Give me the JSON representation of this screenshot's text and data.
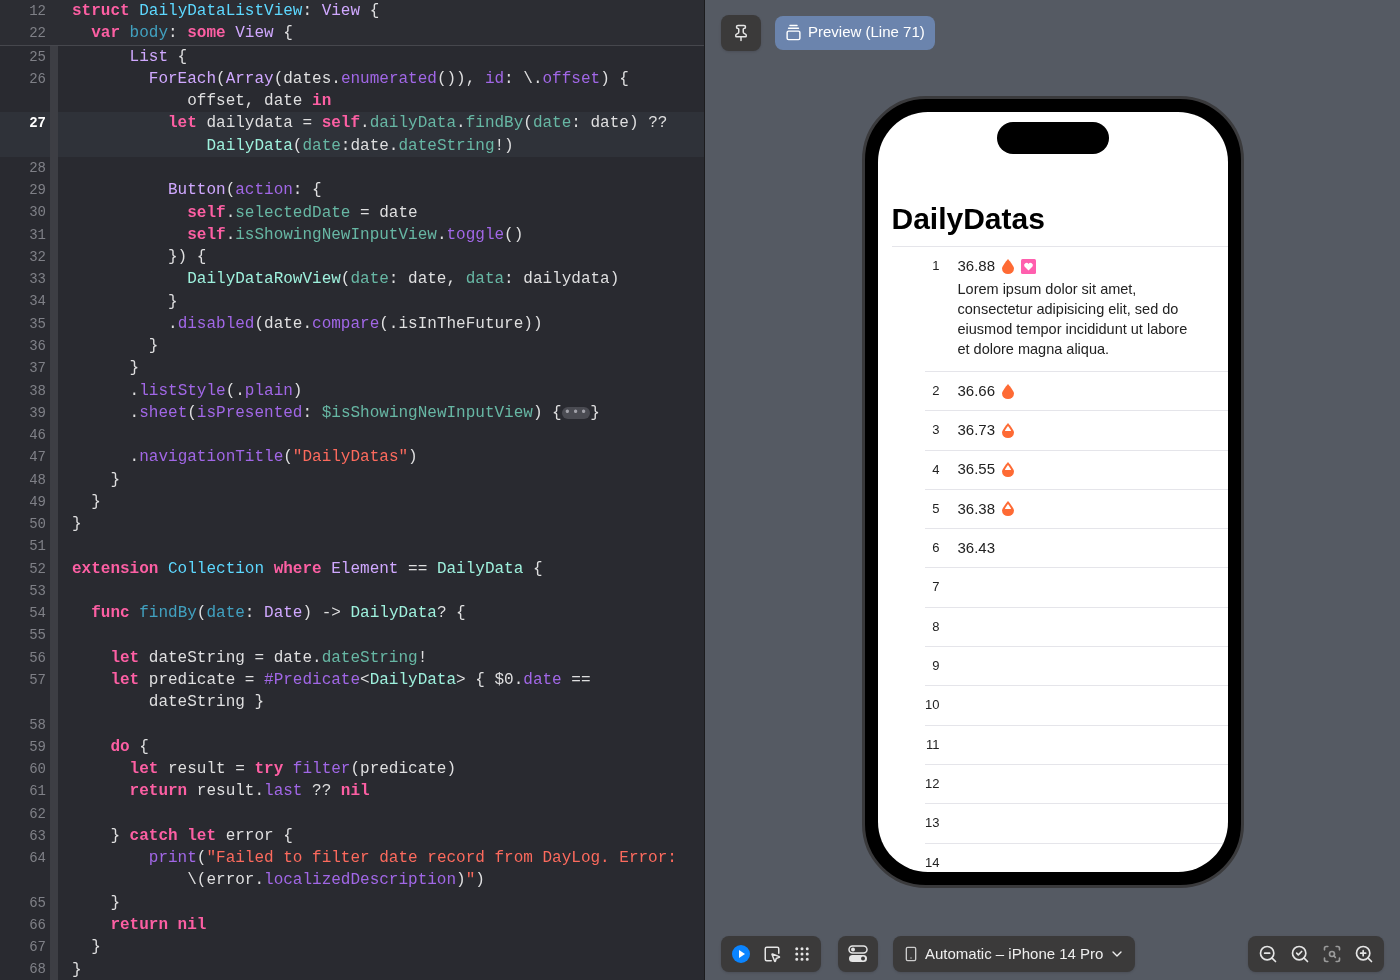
{
  "editor": {
    "sticky_header": [
      {
        "number": "12",
        "segments": [
          {
            "tokens": [
              {
                "kind": "k",
                "text": "struct "
              },
              {
                "kind": "d",
                "text": "DailyDataListView"
              },
              {
                "kind": "t",
                "text": ": "
              },
              {
                "kind": "s",
                "text": "View"
              },
              {
                "kind": "t",
                "text": " {"
              }
            ]
          }
        ]
      },
      {
        "number": "22",
        "segments": [
          {
            "tokens": [
              {
                "kind": "k",
                "text": "  var "
              },
              {
                "kind": "n",
                "text": "body"
              },
              {
                "kind": "t",
                "text": ": "
              },
              {
                "kind": "k",
                "text": "some "
              },
              {
                "kind": "s",
                "text": "View"
              },
              {
                "kind": "t",
                "text": " {"
              }
            ]
          }
        ]
      }
    ],
    "lines": [
      {
        "number": "25",
        "current": false,
        "segments": [
          {
            "tokens": [
              {
                "kind": "s",
                "text": "      List"
              },
              {
                "kind": "t",
                "text": " {"
              }
            ]
          }
        ]
      },
      {
        "number": "26",
        "current": false,
        "segments": [
          {
            "tokens": [
              {
                "kind": "s",
                "text": "        ForEach"
              },
              {
                "kind": "t",
                "text": "("
              },
              {
                "kind": "s",
                "text": "Array"
              },
              {
                "kind": "t",
                "text": "(dates."
              },
              {
                "kind": "m",
                "text": "enumerated"
              },
              {
                "kind": "t",
                "text": "()), "
              },
              {
                "kind": "m",
                "text": "id"
              },
              {
                "kind": "t",
                "text": ": \\."
              },
              {
                "kind": "m",
                "text": "offset"
              },
              {
                "kind": "t",
                "text": ") {"
              }
            ]
          },
          {
            "tokens": [
              {
                "kind": "t",
                "text": "            offset, date "
              },
              {
                "kind": "k",
                "text": "in"
              }
            ]
          }
        ]
      },
      {
        "number": "27",
        "current": true,
        "segments": [
          {
            "tokens": [
              {
                "kind": "k",
                "text": "          let "
              },
              {
                "kind": "t",
                "text": "dailydata = "
              },
              {
                "kind": "k",
                "text": "self"
              },
              {
                "kind": "t",
                "text": "."
              },
              {
                "kind": "v",
                "text": "dailyData"
              },
              {
                "kind": "t",
                "text": "."
              },
              {
                "kind": "v",
                "text": "findBy"
              },
              {
                "kind": "t",
                "text": "("
              },
              {
                "kind": "v",
                "text": "date"
              },
              {
                "kind": "t",
                "text": ": date) ??"
              }
            ]
          },
          {
            "tokens": [
              {
                "kind": "p",
                "text": "              DailyData"
              },
              {
                "kind": "t",
                "text": "("
              },
              {
                "kind": "v",
                "text": "date"
              },
              {
                "kind": "t",
                "text": ":date."
              },
              {
                "kind": "v",
                "text": "dateString"
              },
              {
                "kind": "t",
                "text": "!)"
              }
            ]
          }
        ]
      },
      {
        "number": "28",
        "current": false
      },
      {
        "number": "29",
        "current": false,
        "segments": [
          {
            "tokens": [
              {
                "kind": "s",
                "text": "          Button"
              },
              {
                "kind": "t",
                "text": "("
              },
              {
                "kind": "m",
                "text": "action"
              },
              {
                "kind": "t",
                "text": ": {"
              }
            ]
          }
        ]
      },
      {
        "number": "30",
        "current": false,
        "segments": [
          {
            "tokens": [
              {
                "kind": "k",
                "text": "            self"
              },
              {
                "kind": "t",
                "text": "."
              },
              {
                "kind": "v",
                "text": "selectedDate"
              },
              {
                "kind": "t",
                "text": " = date"
              }
            ]
          }
        ]
      },
      {
        "number": "31",
        "current": false,
        "segments": [
          {
            "tokens": [
              {
                "kind": "k",
                "text": "            self"
              },
              {
                "kind": "t",
                "text": "."
              },
              {
                "kind": "v",
                "text": "isShowingNewInputView"
              },
              {
                "kind": "t",
                "text": "."
              },
              {
                "kind": "m",
                "text": "toggle"
              },
              {
                "kind": "t",
                "text": "()"
              }
            ]
          }
        ]
      },
      {
        "number": "32",
        "current": false,
        "segments": [
          {
            "tokens": [
              {
                "kind": "t",
                "text": "          }) {"
              }
            ]
          }
        ]
      },
      {
        "number": "33",
        "current": false,
        "segments": [
          {
            "tokens": [
              {
                "kind": "p",
                "text": "            DailyDataRowView"
              },
              {
                "kind": "t",
                "text": "("
              },
              {
                "kind": "v",
                "text": "date"
              },
              {
                "kind": "t",
                "text": ": date, "
              },
              {
                "kind": "v",
                "text": "data"
              },
              {
                "kind": "t",
                "text": ": dailydata)"
              }
            ]
          }
        ]
      },
      {
        "number": "34",
        "current": false,
        "segments": [
          {
            "tokens": [
              {
                "kind": "t",
                "text": "          }"
              }
            ]
          }
        ]
      },
      {
        "number": "35",
        "current": false,
        "segments": [
          {
            "tokens": [
              {
                "kind": "t",
                "text": "          ."
              },
              {
                "kind": "m",
                "text": "disabled"
              },
              {
                "kind": "t",
                "text": "(date."
              },
              {
                "kind": "m",
                "text": "compare"
              },
              {
                "kind": "t",
                "text": "(.isInTheFuture))"
              }
            ]
          }
        ]
      },
      {
        "number": "36",
        "current": false,
        "segments": [
          {
            "tokens": [
              {
                "kind": "t",
                "text": "        }"
              }
            ]
          }
        ]
      },
      {
        "number": "37",
        "current": false,
        "segments": [
          {
            "tokens": [
              {
                "kind": "t",
                "text": "      }"
              }
            ]
          }
        ]
      },
      {
        "number": "38",
        "current": false,
        "segments": [
          {
            "tokens": [
              {
                "kind": "t",
                "text": "      ."
              },
              {
                "kind": "m",
                "text": "listStyle"
              },
              {
                "kind": "t",
                "text": "(."
              },
              {
                "kind": "m",
                "text": "plain"
              },
              {
                "kind": "t",
                "text": ")"
              }
            ]
          }
        ]
      },
      {
        "number": "39",
        "current": false,
        "segments": [
          {
            "tokens": [
              {
                "kind": "t",
                "text": "      ."
              },
              {
                "kind": "m",
                "text": "sheet"
              },
              {
                "kind": "t",
                "text": "("
              },
              {
                "kind": "m",
                "text": "isPresented"
              },
              {
                "kind": "t",
                "text": ": "
              },
              {
                "kind": "v",
                "text": "$isShowingNewInputView"
              },
              {
                "kind": "t",
                "text": ") {"
              },
              {
                "kind": "f",
                "text": "•••"
              },
              {
                "kind": "t",
                "text": "}"
              }
            ]
          }
        ]
      },
      {
        "number": "46",
        "current": false
      },
      {
        "number": "47",
        "current": false,
        "segments": [
          {
            "tokens": [
              {
                "kind": "t",
                "text": "      ."
              },
              {
                "kind": "m",
                "text": "navigationTitle"
              },
              {
                "kind": "t",
                "text": "("
              },
              {
                "kind": "q",
                "text": "\"DailyDatas\""
              },
              {
                "kind": "t",
                "text": ")"
              }
            ]
          }
        ]
      },
      {
        "number": "48",
        "current": false,
        "segments": [
          {
            "tokens": [
              {
                "kind": "t",
                "text": "    }"
              }
            ]
          }
        ]
      },
      {
        "number": "49",
        "current": false,
        "segments": [
          {
            "tokens": [
              {
                "kind": "t",
                "text": "  }"
              }
            ]
          }
        ]
      },
      {
        "number": "50",
        "current": false,
        "segments": [
          {
            "tokens": [
              {
                "kind": "t",
                "text": "}"
              }
            ]
          }
        ]
      },
      {
        "number": "51",
        "current": false
      },
      {
        "number": "52",
        "current": false,
        "segments": [
          {
            "tokens": [
              {
                "kind": "k",
                "text": "extension "
              },
              {
                "kind": "d",
                "text": "Collection"
              },
              {
                "kind": "k",
                "text": " where "
              },
              {
                "kind": "s",
                "text": "Element"
              },
              {
                "kind": "t",
                "text": " == "
              },
              {
                "kind": "p",
                "text": "DailyData"
              },
              {
                "kind": "t",
                "text": " {"
              }
            ]
          }
        ]
      },
      {
        "number": "53",
        "current": false
      },
      {
        "number": "54",
        "current": false,
        "segments": [
          {
            "tokens": [
              {
                "kind": "k",
                "text": "  func "
              },
              {
                "kind": "n",
                "text": "findBy"
              },
              {
                "kind": "t",
                "text": "("
              },
              {
                "kind": "n",
                "text": "date"
              },
              {
                "kind": "t",
                "text": ": "
              },
              {
                "kind": "s",
                "text": "Date"
              },
              {
                "kind": "t",
                "text": ") -> "
              },
              {
                "kind": "p",
                "text": "DailyData"
              },
              {
                "kind": "t",
                "text": "? {"
              }
            ]
          }
        ]
      },
      {
        "number": "55",
        "current": false
      },
      {
        "number": "56",
        "current": false,
        "segments": [
          {
            "tokens": [
              {
                "kind": "k",
                "text": "    let "
              },
              {
                "kind": "t",
                "text": "dateString = date."
              },
              {
                "kind": "v",
                "text": "dateString"
              },
              {
                "kind": "t",
                "text": "!"
              }
            ]
          }
        ]
      },
      {
        "number": "57",
        "current": false,
        "segments": [
          {
            "tokens": [
              {
                "kind": "k",
                "text": "    let "
              },
              {
                "kind": "t",
                "text": "predicate = "
              },
              {
                "kind": "m",
                "text": "#Predicate"
              },
              {
                "kind": "t",
                "text": "<"
              },
              {
                "kind": "p",
                "text": "DailyData"
              },
              {
                "kind": "t",
                "text": "> { $0."
              },
              {
                "kind": "m",
                "text": "date"
              },
              {
                "kind": "t",
                "text": " =="
              }
            ]
          },
          {
            "tokens": [
              {
                "kind": "t",
                "text": "        dateString }"
              }
            ]
          }
        ]
      },
      {
        "number": "58",
        "current": false
      },
      {
        "number": "59",
        "current": false,
        "segments": [
          {
            "tokens": [
              {
                "kind": "k",
                "text": "    do"
              },
              {
                "kind": "t",
                "text": " {"
              }
            ]
          }
        ]
      },
      {
        "number": "60",
        "current": false,
        "segments": [
          {
            "tokens": [
              {
                "kind": "k",
                "text": "      let "
              },
              {
                "kind": "t",
                "text": "result = "
              },
              {
                "kind": "k",
                "text": "try "
              },
              {
                "kind": "m",
                "text": "filter"
              },
              {
                "kind": "t",
                "text": "(predicate)"
              }
            ]
          }
        ]
      },
      {
        "number": "61",
        "current": false,
        "segments": [
          {
            "tokens": [
              {
                "kind": "k",
                "text": "      return "
              },
              {
                "kind": "t",
                "text": "result."
              },
              {
                "kind": "m",
                "text": "last"
              },
              {
                "kind": "t",
                "text": " ?? "
              },
              {
                "kind": "k",
                "text": "nil"
              }
            ]
          }
        ]
      },
      {
        "number": "62",
        "current": false
      },
      {
        "number": "63",
        "current": false,
        "segments": [
          {
            "tokens": [
              {
                "kind": "t",
                "text": "    } "
              },
              {
                "kind": "k",
                "text": "catch let "
              },
              {
                "kind": "t",
                "text": "error {"
              }
            ]
          }
        ]
      },
      {
        "number": "64",
        "current": false,
        "segments": [
          {
            "tokens": [
              {
                "kind": "m",
                "text": "        print"
              },
              {
                "kind": "t",
                "text": "("
              },
              {
                "kind": "q",
                "text": "\"Failed to filter date record from DayLog. Error:"
              }
            ]
          },
          {
            "tokens": [
              {
                "kind": "t",
                "text": "            \\(error."
              },
              {
                "kind": "m",
                "text": "localizedDescription"
              },
              {
                "kind": "t",
                "text": ")"
              },
              {
                "kind": "q",
                "text": "\""
              },
              {
                "kind": "t",
                "text": ")"
              }
            ]
          }
        ]
      },
      {
        "number": "65",
        "current": false,
        "segments": [
          {
            "tokens": [
              {
                "kind": "t",
                "text": "    }"
              }
            ]
          }
        ]
      },
      {
        "number": "66",
        "current": false,
        "segments": [
          {
            "tokens": [
              {
                "kind": "k",
                "text": "    return nil"
              }
            ]
          }
        ]
      },
      {
        "number": "67",
        "current": false,
        "segments": [
          {
            "tokens": [
              {
                "kind": "t",
                "text": "  }"
              }
            ]
          }
        ]
      },
      {
        "number": "68",
        "current": false,
        "segments": [
          {
            "tokens": [
              {
                "kind": "t",
                "text": "}"
              }
            ]
          }
        ]
      }
    ]
  },
  "preview": {
    "tab": {
      "label": "Preview (Line 71)",
      "selected": true
    },
    "screen": {
      "title": "DailyDatas",
      "rows": [
        {
          "number": "1",
          "value": "36.88",
          "icons": [
            {
              "kind": "drop"
            },
            {
              "kind": "heart"
            }
          ],
          "note": "Lorem ipsum dolor sit amet, consectetur adipisicing elit, sed do eiusmod tempor incididunt ut labore et dolore magna aliqua."
        },
        {
          "number": "2",
          "value": "36.66",
          "icons": [
            {
              "kind": "drop"
            }
          ]
        },
        {
          "number": "3",
          "value": "36.73",
          "icons": [
            {
              "kind": "drop-half"
            }
          ]
        },
        {
          "number": "4",
          "value": "36.55",
          "icons": [
            {
              "kind": "drop-half"
            }
          ]
        },
        {
          "number": "5",
          "value": "36.38",
          "icons": [
            {
              "kind": "drop-half"
            }
          ]
        },
        {
          "number": "6",
          "value": "36.43"
        },
        {
          "number": "7"
        },
        {
          "number": "8"
        },
        {
          "number": "9"
        },
        {
          "number": "10"
        },
        {
          "number": "11"
        },
        {
          "number": "12"
        },
        {
          "number": "13"
        },
        {
          "number": "14"
        }
      ]
    },
    "modes": [
      {
        "kind": "live",
        "selected": true
      },
      {
        "kind": "select",
        "selected": false
      },
      {
        "kind": "variants",
        "selected": false
      }
    ],
    "device": "Automatic – iPhone 14 Pro"
  }
}
